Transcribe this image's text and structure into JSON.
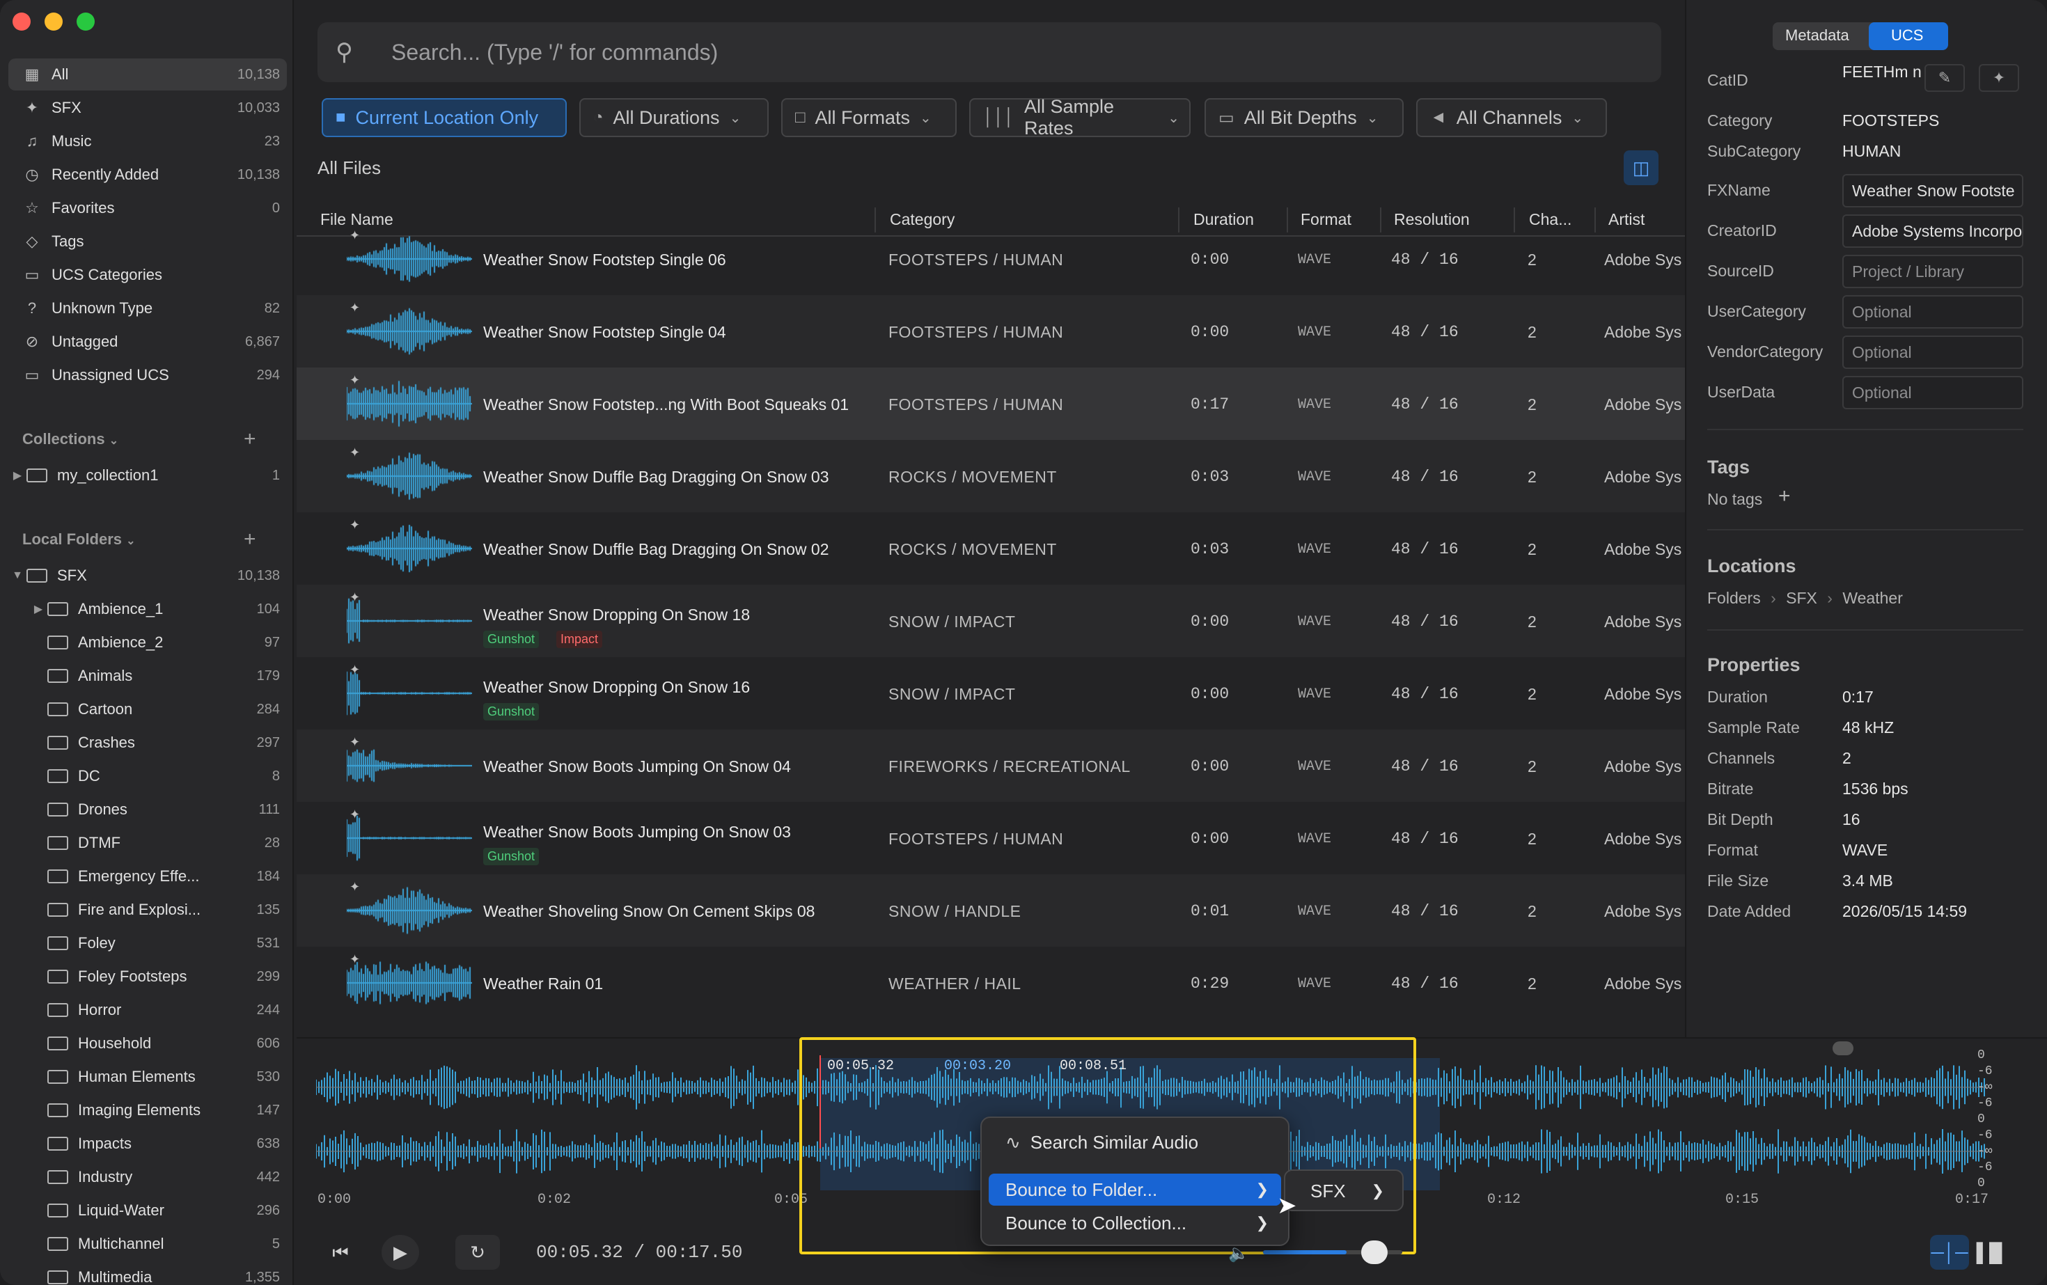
{
  "window": {
    "traffic_lights": [
      "#ff5f57",
      "#febc2e",
      "#28c840"
    ]
  },
  "sidebar": {
    "items": [
      {
        "label": "All",
        "count": "10,138",
        "icon": "grid-icon"
      },
      {
        "label": "SFX",
        "count": "10,033",
        "icon": "sparkle-icon"
      },
      {
        "label": "Music",
        "count": "23",
        "icon": "music-note-icon"
      },
      {
        "label": "Recently Added",
        "count": "10,138",
        "icon": "clock-icon"
      },
      {
        "label": "Favorites",
        "count": "0",
        "icon": "star-icon"
      },
      {
        "label": "Tags",
        "count": "",
        "icon": "tag-icon"
      },
      {
        "label": "UCS Categories",
        "count": "",
        "icon": "folder-icon"
      },
      {
        "label": "Unknown Type",
        "count": "82",
        "icon": "question-icon"
      },
      {
        "label": "Untagged",
        "count": "6,867",
        "icon": "untag-icon"
      },
      {
        "label": "Unassigned UCS",
        "count": "294",
        "icon": "folder-icon"
      }
    ],
    "collections_header": "Collections",
    "collections": [
      {
        "label": "my_collection1",
        "count": "1"
      }
    ],
    "local_folders_header": "Local Folders",
    "root_folder": {
      "label": "SFX",
      "count": "10,138"
    },
    "folders": [
      {
        "label": "Ambience_1",
        "count": "104",
        "expandable": true
      },
      {
        "label": "Ambience_2",
        "count": "97"
      },
      {
        "label": "Animals",
        "count": "179"
      },
      {
        "label": "Cartoon",
        "count": "284"
      },
      {
        "label": "Crashes",
        "count": "297"
      },
      {
        "label": "DC",
        "count": "8"
      },
      {
        "label": "Drones",
        "count": "111"
      },
      {
        "label": "DTMF",
        "count": "28"
      },
      {
        "label": "Emergency Effe...",
        "count": "184"
      },
      {
        "label": "Fire and Explosi...",
        "count": "135"
      },
      {
        "label": "Foley",
        "count": "531"
      },
      {
        "label": "Foley Footsteps",
        "count": "299"
      },
      {
        "label": "Horror",
        "count": "244"
      },
      {
        "label": "Household",
        "count": "606"
      },
      {
        "label": "Human Elements",
        "count": "530"
      },
      {
        "label": "Imaging Elements",
        "count": "147"
      },
      {
        "label": "Impacts",
        "count": "638"
      },
      {
        "label": "Industry",
        "count": "442"
      },
      {
        "label": "Liquid-Water",
        "count": "296"
      },
      {
        "label": "Multichannel",
        "count": "5"
      },
      {
        "label": "Multimedia",
        "count": "1,355"
      }
    ]
  },
  "search": {
    "placeholder": "Search... (Type '/' for commands)"
  },
  "filters": [
    "Current Location Only",
    "All Durations",
    "All Formats",
    "All Sample Rates",
    "All Bit Depths",
    "All Channels"
  ],
  "list_title": "All Files",
  "columns": [
    "File Name",
    "Category",
    "Duration",
    "Format",
    "Resolution",
    "Cha...",
    "Artist"
  ],
  "rows": [
    {
      "name": "Weather Snow Footstep Single 06",
      "category": "FOOTSTEPS / HUMAN",
      "duration": "0:00",
      "format": "WAVE",
      "resolution": "48 / 16",
      "channels": "2",
      "artist": "Adobe Sys",
      "tags": []
    },
    {
      "name": "Weather Snow Footstep Single 04",
      "category": "FOOTSTEPS / HUMAN",
      "duration": "0:00",
      "format": "WAVE",
      "resolution": "48 / 16",
      "channels": "2",
      "artist": "Adobe Sys",
      "tags": []
    },
    {
      "name": "Weather Snow Footstep...ng With Boot Squeaks 01",
      "category": "FOOTSTEPS / HUMAN",
      "duration": "0:17",
      "format": "WAVE",
      "resolution": "48 / 16",
      "channels": "2",
      "artist": "Adobe Sys",
      "tags": [],
      "selected": true
    },
    {
      "name": "Weather Snow Duffle Bag Dragging On Snow 03",
      "category": "ROCKS / MOVEMENT",
      "duration": "0:03",
      "format": "WAVE",
      "resolution": "48 / 16",
      "channels": "2",
      "artist": "Adobe Sys",
      "tags": []
    },
    {
      "name": "Weather Snow Duffle Bag Dragging On Snow 02",
      "category": "ROCKS / MOVEMENT",
      "duration": "0:03",
      "format": "WAVE",
      "resolution": "48 / 16",
      "channels": "2",
      "artist": "Adobe Sys",
      "tags": []
    },
    {
      "name": "Weather Snow Dropping On Snow 18",
      "category": "SNOW / IMPACT",
      "duration": "0:00",
      "format": "WAVE",
      "resolution": "48 / 16",
      "channels": "2",
      "artist": "Adobe Sys",
      "tags": [
        "Gunshot",
        "Impact"
      ]
    },
    {
      "name": "Weather Snow Dropping On Snow 16",
      "category": "SNOW / IMPACT",
      "duration": "0:00",
      "format": "WAVE",
      "resolution": "48 / 16",
      "channels": "2",
      "artist": "Adobe Sys",
      "tags": [
        "Gunshot"
      ]
    },
    {
      "name": "Weather Snow Boots Jumping On Snow 04",
      "category": "FIREWORKS / RECREATIONAL",
      "duration": "0:00",
      "format": "WAVE",
      "resolution": "48 / 16",
      "channels": "2",
      "artist": "Adobe Sys",
      "tags": []
    },
    {
      "name": "Weather Snow Boots Jumping On Snow 03",
      "category": "FOOTSTEPS / HUMAN",
      "duration": "0:00",
      "format": "WAVE",
      "resolution": "48 / 16",
      "channels": "2",
      "artist": "Adobe Sys",
      "tags": [
        "Gunshot"
      ]
    },
    {
      "name": "Weather Shoveling Snow On Cement Skips 08",
      "category": "SNOW / HANDLE",
      "duration": "0:01",
      "format": "WAVE",
      "resolution": "48 / 16",
      "channels": "2",
      "artist": "Adobe Sys",
      "tags": []
    },
    {
      "name": "Weather Rain 01",
      "category": "WEATHER / HAIL",
      "duration": "0:29",
      "format": "WAVE",
      "resolution": "48 / 16",
      "channels": "2",
      "artist": "Adobe Sys",
      "tags": []
    }
  ],
  "panel": {
    "tabs": [
      "Metadata",
      "UCS"
    ],
    "active_tab": "UCS",
    "ucs": {
      "catid_label": "CatID",
      "catid_value": "FEETHm n",
      "category_label": "Category",
      "category_value": "FOOTSTEPS",
      "subcategory_label": "SubCategory",
      "subcategory_value": "HUMAN",
      "fxname_label": "FXName",
      "fxname_value": "Weather Snow Footste",
      "creatorid_label": "CreatorID",
      "creatorid_value": "Adobe Systems Incorpo",
      "sourceid_label": "SourceID",
      "sourceid_placeholder": "Project / Library",
      "usercategory_label": "UserCategory",
      "usercategory_placeholder": "Optional",
      "vendorcategory_label": "VendorCategory",
      "vendorcategory_placeholder": "Optional",
      "userdata_label": "UserData",
      "userdata_placeholder": "Optional"
    },
    "tags_header": "Tags",
    "tags_empty": "No tags",
    "locations_header": "Locations",
    "location_path": [
      "Folders",
      "SFX",
      "Weather"
    ],
    "properties_header": "Properties",
    "properties": [
      {
        "label": "Duration",
        "value": "0:17"
      },
      {
        "label": "Sample Rate",
        "value": "48 kHZ"
      },
      {
        "label": "Channels",
        "value": "2"
      },
      {
        "label": "Bitrate",
        "value": "1536 bps"
      },
      {
        "label": "Bit Depth",
        "value": "16"
      },
      {
        "label": "Format",
        "value": "WAVE"
      },
      {
        "label": "File Size",
        "value": "3.4 MB"
      },
      {
        "label": "Date Added",
        "value": "2026/05/15 14:59"
      }
    ]
  },
  "player": {
    "sel_start": "00:05.32",
    "sel_length": "00:03.20",
    "sel_end": "00:08.51",
    "ticks": [
      "0:00",
      "0:02",
      "0:05",
      "0:12",
      "0:15",
      "0:17"
    ],
    "db_scale": [
      "0",
      "-6",
      "-∞",
      "-6",
      "0",
      "-6",
      "-∞",
      "-6",
      "0"
    ],
    "timecode": "00:05.32 / 00:17.50",
    "volume_fraction": 0.6,
    "waveform_color": "#3aa3d8"
  },
  "context_menu": {
    "items": [
      "Search Similar Audio",
      "Bounce to Folder...",
      "Bounce to Collection..."
    ],
    "submenu": [
      "SFX"
    ]
  }
}
